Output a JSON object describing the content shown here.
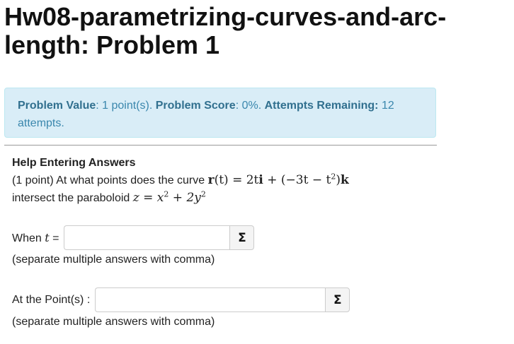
{
  "header": {
    "title": "Hw08-parametrizing-curves-and-arc-length: Problem 1"
  },
  "info": {
    "value_label": "Problem Value",
    "value_text": ": 1 point(s).",
    "score_label": "Problem Score",
    "score_text": ": 0%.",
    "attempts_label": "Attempts Remaining:",
    "attempts_text": "12 attempts."
  },
  "problem": {
    "help_link": "Help Entering Answers",
    "prefix": "(1 point) At what points does the curve",
    "curve_r": "r",
    "curve_lhs": "(t) = 2t",
    "curve_i": "i",
    "curve_mid": " + (−3t − t",
    "curve_exp": "2",
    "curve_close": ")",
    "curve_k": "k",
    "line2": "intersect the paraboloid",
    "par_lhs": "z = x",
    "par_exp1": "2",
    "par_mid": " + 2y",
    "par_exp2": "2"
  },
  "answers": [
    {
      "label_pre": "When",
      "label_var": "t",
      "label_post": "=",
      "value": "",
      "hint": "(separate multiple answers with comma)"
    },
    {
      "label": "At the Point(s) :",
      "value": "",
      "hint": "(separate multiple answers with comma)"
    }
  ],
  "sigma_symbol": "Σ",
  "colors": {
    "info_bg": "#d9edf7",
    "info_text": "#3a87ad"
  }
}
